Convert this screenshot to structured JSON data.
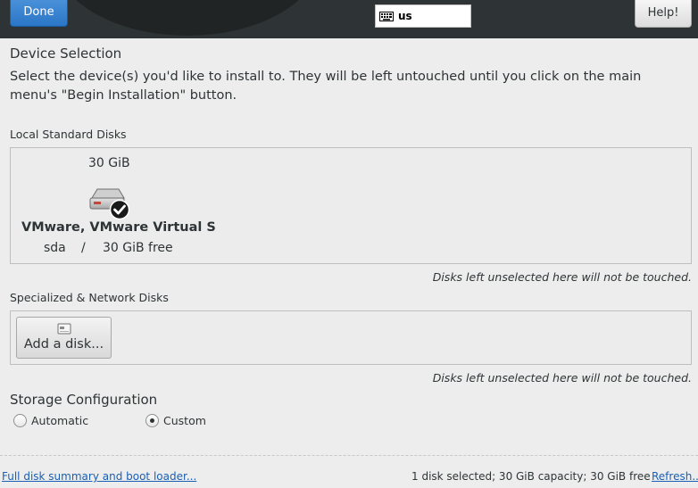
{
  "header": {
    "done_label": "Done",
    "keyboard_layout": "us",
    "help_label": "Help!"
  },
  "page": {
    "title": "Device Selection",
    "description": "Select the device(s) you'd like to install to.  They will be left untouched until you click on the main menu's \"Begin Installation\" button."
  },
  "local_disks": {
    "label": "Local Standard Disks",
    "disks": [
      {
        "size": "30 GiB",
        "name": "VMware, VMware Virtual S",
        "device": "sda",
        "separator": "/",
        "free": "30 GiB free",
        "selected": true
      }
    ],
    "note": "Disks left unselected here will not be touched."
  },
  "network_disks": {
    "label": "Specialized & Network Disks",
    "add_button_label": "Add a disk...",
    "note": "Disks left unselected here will not be touched."
  },
  "storage_config": {
    "title": "Storage Configuration",
    "options": [
      {
        "label": "Automatic",
        "checked": false
      },
      {
        "label": "Custom",
        "checked": true
      }
    ]
  },
  "footer": {
    "summary_link": "Full disk summary and boot loader...",
    "status": "1 disk selected; 30 GiB capacity; 30 GiB free",
    "refresh_link": "Refresh..."
  },
  "colors": {
    "header_bg": "#2e3436",
    "accent": "#2a76c6",
    "link": "#1a5fb4",
    "background": "#ededed"
  }
}
